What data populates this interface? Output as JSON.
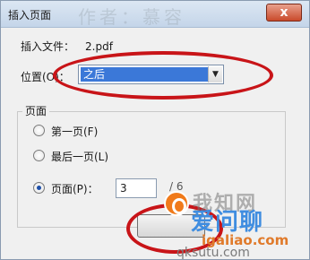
{
  "window": {
    "title": "插入页面",
    "title_watermark": "作者：慕容",
    "close_label": "x"
  },
  "file": {
    "label": "插入文件：",
    "value": "2.pdf"
  },
  "position": {
    "label": "位置(O)：",
    "selected": "之后",
    "arrow_glyph": "▼"
  },
  "pages_group": {
    "title": "页面",
    "options": [
      {
        "label": "第一页(F)",
        "checked": false
      },
      {
        "label": "最后一页(L)",
        "checked": false
      },
      {
        "label": "页面(P)：",
        "checked": true
      }
    ],
    "page_value": "3",
    "slash": "/ 6"
  },
  "ok_button": {
    "label": ""
  },
  "watermark": {
    "chinese": "我知网",
    "brand": "爱问聊",
    "site": "igaliao.com",
    "site2": "qksutu.com"
  },
  "colors": {
    "accent_select": "#3b78d8",
    "annotation_red": "#c81418",
    "close_red": "#c94a2b"
  },
  "icons": {
    "close": "close-icon",
    "dropdown": "chevron-down-icon",
    "watermark_logo": "logo-icon"
  }
}
